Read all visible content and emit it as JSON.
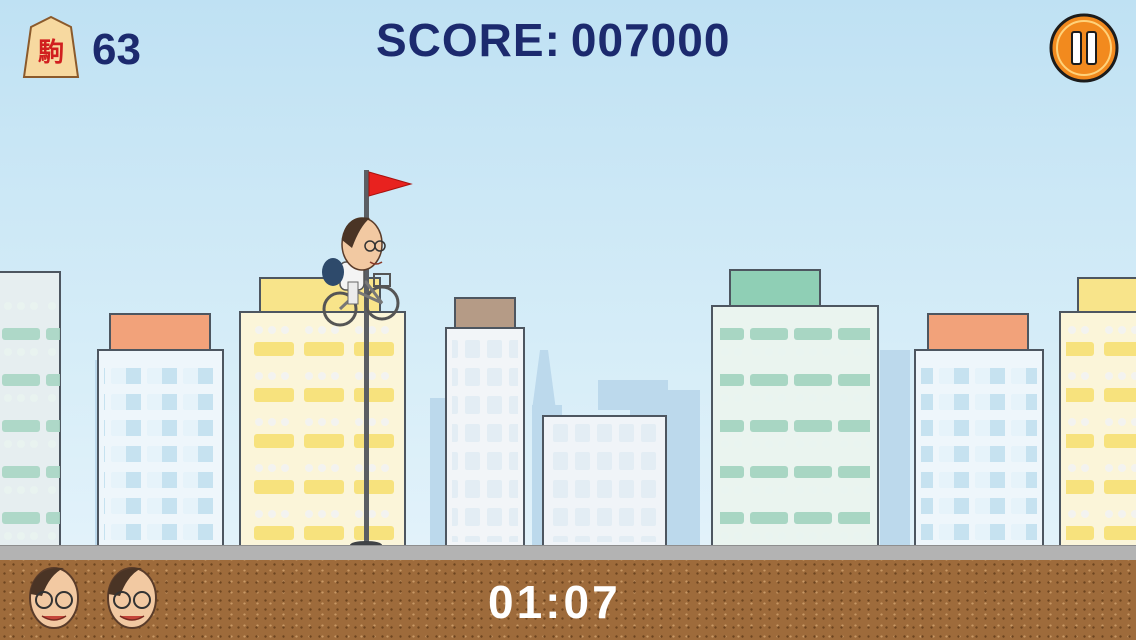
{
  "hud": {
    "piece_glyph": "駒",
    "piece_count": "63",
    "score_label": "SCORE:",
    "score_value": "007000",
    "pause_icon": "pause-icon"
  },
  "timer": "01:07",
  "lives": 2,
  "icons": {
    "piece": "shogi-piece-icon",
    "life": "player-face-icon",
    "flag": "checkpoint-flag"
  },
  "colors": {
    "hud_text": "#1c2a6e",
    "pause": "#f28a1e",
    "flag": "#e8221f",
    "ground": "#9e6b3b",
    "sky": "#c8e6f5"
  }
}
